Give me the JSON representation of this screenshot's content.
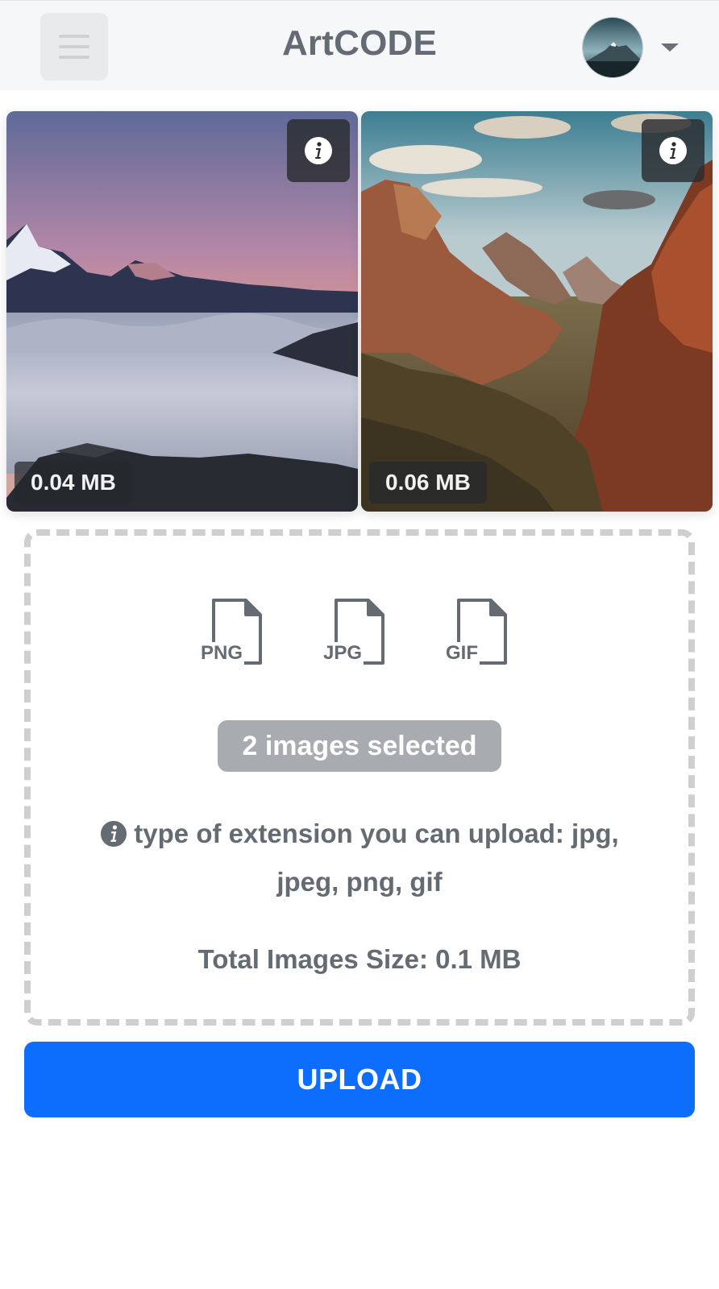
{
  "header": {
    "brand": "ArtCODE",
    "menu_icon": "hamburger-menu-icon",
    "avatar_icon": "user-avatar",
    "dropdown_icon": "caret-down-icon"
  },
  "images": [
    {
      "size_label": "0.04 MB",
      "info_icon": "info-icon",
      "subject": "mountains above sea of clouds at sunset"
    },
    {
      "size_label": "0.06 MB",
      "info_icon": "info-icon",
      "subject": "red rock canyon valley"
    }
  ],
  "dropzone": {
    "file_types": [
      "PNG",
      "JPG",
      "GIF"
    ],
    "selected_label": "2 images selected",
    "hint_text": "type of extension you can upload: jpg, jpeg, png, gif",
    "total_size_label": "Total Images Size: 0.1 MB"
  },
  "upload_label": "UPLOAD",
  "colors": {
    "primary": "#0d6efd",
    "text_muted": "#656b72",
    "badge_bg": "#a8acb1",
    "dash_border": "#cfcfcf",
    "navbar_bg": "#f6f7f9"
  }
}
